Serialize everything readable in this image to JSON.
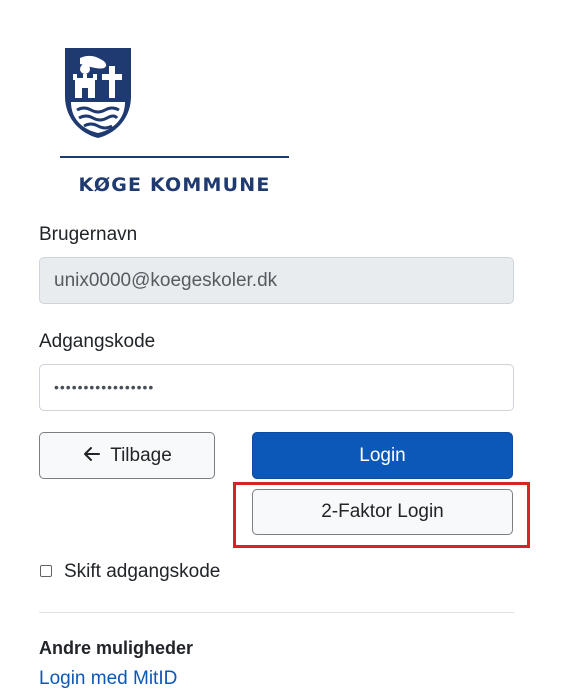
{
  "brand": {
    "name": "KØGE KOMMUNE",
    "color": "#1f3a70",
    "crest_icon": "koege-coat-of-arms"
  },
  "form": {
    "username": {
      "label": "Brugernavn",
      "value": "unix0000@koegeskoler.dk",
      "readonly": true
    },
    "password": {
      "label": "Adgangskode",
      "value": "•••••••••••••••••"
    },
    "buttons": {
      "back_label": "Tilbage",
      "back_icon": "arrow-left-icon",
      "login_label": "Login",
      "two_factor_label": "2-Faktor Login"
    },
    "change_password": {
      "label": "Skift adgangskode",
      "checked": false
    }
  },
  "alternatives": {
    "title": "Andre muligheder",
    "mitid_link": "Login med MitID"
  },
  "colors": {
    "primary": "#0b58b8",
    "highlight_box": "#d72228",
    "readonly_bg": "#e9ecef"
  }
}
